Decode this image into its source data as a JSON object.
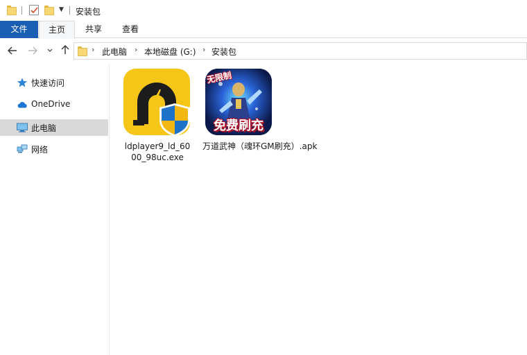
{
  "window": {
    "title": "安装包"
  },
  "ribbon": {
    "tabs": [
      {
        "label": "文件"
      },
      {
        "label": "主页"
      },
      {
        "label": "共享"
      },
      {
        "label": "查看"
      }
    ]
  },
  "address": {
    "crumbs": [
      "此电脑",
      "本地磁盘 (G:)",
      "安装包"
    ]
  },
  "navpane": {
    "items": [
      {
        "label": "快速访问",
        "icon": "star-icon"
      },
      {
        "label": "OneDrive",
        "icon": "cloud-icon"
      },
      {
        "label": "此电脑",
        "icon": "computer-icon",
        "selected": true
      },
      {
        "label": "网络",
        "icon": "network-icon"
      }
    ]
  },
  "files": [
    {
      "label": "ldplayer9_ld_6000_98uc.exe",
      "label_lines": [
        "ldplayer9_ld_60",
        "00_98uc.exe"
      ],
      "icon": "ldplayer-icon"
    },
    {
      "label": "万道武神（魂环GM刷充）.apk",
      "icon": "game-app-icon",
      "badge_top": "无限制",
      "badge_bottom": "免费刷充"
    }
  ],
  "colors": {
    "file_tab": "#1a5fb4",
    "selected_nav": "#d9d9d9",
    "ldplayer_bg": "#f5c518"
  }
}
